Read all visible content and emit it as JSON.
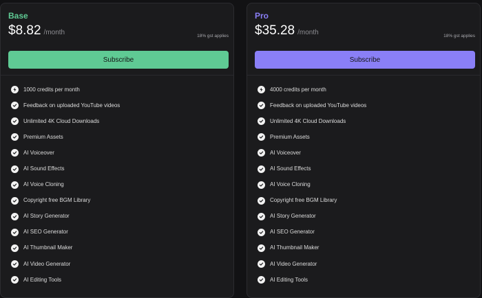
{
  "colors": {
    "base_accent": "#5fca94",
    "pro_accent": "#8a7ff7",
    "card_background": "#1b1b1d",
    "page_background": "#121214"
  },
  "plans": [
    {
      "name": "Base",
      "price": "$8.82",
      "period": "/month",
      "tax_note": "18% gst applies",
      "button_label": "Subscribe",
      "features": [
        {
          "icon": "bolt-icon",
          "label": "1000 credits per month"
        },
        {
          "icon": "check-circle-icon",
          "label": "Feedback on uploaded YouTube videos"
        },
        {
          "icon": "check-circle-icon",
          "label": "Unlimited 4K Cloud Downloads"
        },
        {
          "icon": "check-circle-icon",
          "label": "Premium Assets"
        },
        {
          "icon": "check-circle-icon",
          "label": "AI Voiceover"
        },
        {
          "icon": "check-circle-icon",
          "label": "AI Sound Effects"
        },
        {
          "icon": "check-circle-icon",
          "label": "AI Voice Cloning"
        },
        {
          "icon": "check-circle-icon",
          "label": "Copyright free BGM Library"
        },
        {
          "icon": "check-circle-icon",
          "label": "AI Story Generator"
        },
        {
          "icon": "check-circle-icon",
          "label": "AI SEO Generator"
        },
        {
          "icon": "check-circle-icon",
          "label": "AI Thumbnail Maker"
        },
        {
          "icon": "check-circle-icon",
          "label": "AI Video Generator"
        },
        {
          "icon": "check-circle-icon",
          "label": "AI Editing Tools"
        }
      ]
    },
    {
      "name": "Pro",
      "price": "$35.28",
      "period": "/month",
      "tax_note": "18% gst applies",
      "button_label": "Subscribe",
      "features": [
        {
          "icon": "bolt-icon",
          "label": "4000 credits per month"
        },
        {
          "icon": "check-circle-icon",
          "label": "Feedback on uploaded YouTube videos"
        },
        {
          "icon": "check-circle-icon",
          "label": "Unlimited 4K Cloud Downloads"
        },
        {
          "icon": "check-circle-icon",
          "label": "Premium Assets"
        },
        {
          "icon": "check-circle-icon",
          "label": "AI Voiceover"
        },
        {
          "icon": "check-circle-icon",
          "label": "AI Sound Effects"
        },
        {
          "icon": "check-circle-icon",
          "label": "AI Voice Cloning"
        },
        {
          "icon": "check-circle-icon",
          "label": "Copyright free BGM Library"
        },
        {
          "icon": "check-circle-icon",
          "label": "AI Story Generator"
        },
        {
          "icon": "check-circle-icon",
          "label": "AI SEO Generator"
        },
        {
          "icon": "check-circle-icon",
          "label": "AI Thumbnail Maker"
        },
        {
          "icon": "check-circle-icon",
          "label": "AI Video Generator"
        },
        {
          "icon": "check-circle-icon",
          "label": "AI Editing Tools"
        }
      ]
    }
  ]
}
